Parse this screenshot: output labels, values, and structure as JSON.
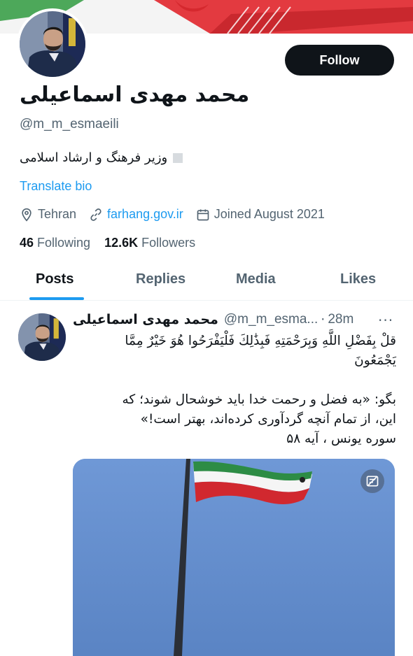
{
  "profile": {
    "display_name": "محمد مهدی اسماعیلی",
    "handle": "@m_m_esmaeili",
    "bio": "وزیر فرهنگ و ارشاد اسلامی",
    "translate_label": "Translate bio",
    "location": "Tehran",
    "website": "farhang.gov.ir",
    "joined": "Joined August 2021",
    "following_count": "46",
    "following_label": "Following",
    "followers_count": "12.6K",
    "followers_label": "Followers",
    "follow_label": "Follow"
  },
  "tabs": [
    {
      "label": "Posts",
      "active": true
    },
    {
      "label": "Replies",
      "active": false
    },
    {
      "label": "Media",
      "active": false
    },
    {
      "label": "Likes",
      "active": false
    }
  ],
  "tweet": {
    "author_name": "محمد مهدی اسماعیلی",
    "author_handle": "@m_m_esma...",
    "time": "28m",
    "lines": [
      "قلْ بِفَضْلِ اللَّهِ وَبِرَحْمَتِهِ فَبِذَٰلِكَ فَلْيَفْرَحُوا هُوَ خَيْرٌ مِمَّا",
      "يَجْمَعُونَ",
      "بگو: «به فضل و رحمت خدا باید خوشحال شوند؛ که",
      "این، از تمام آنچه گردآوری کرده‌اند، بهتر است!»",
      "سوره یونس ، آیه ۵۸"
    ]
  },
  "icons": {
    "location": "location-pin-icon",
    "link": "link-icon",
    "calendar": "calendar-icon",
    "more": "more-options-icon",
    "media_badge": "media-badge-icon"
  },
  "colors": {
    "accent": "#1d9bf0",
    "text": "#0f1419",
    "secondary": "#536471",
    "follow_bg": "#0f1419"
  }
}
